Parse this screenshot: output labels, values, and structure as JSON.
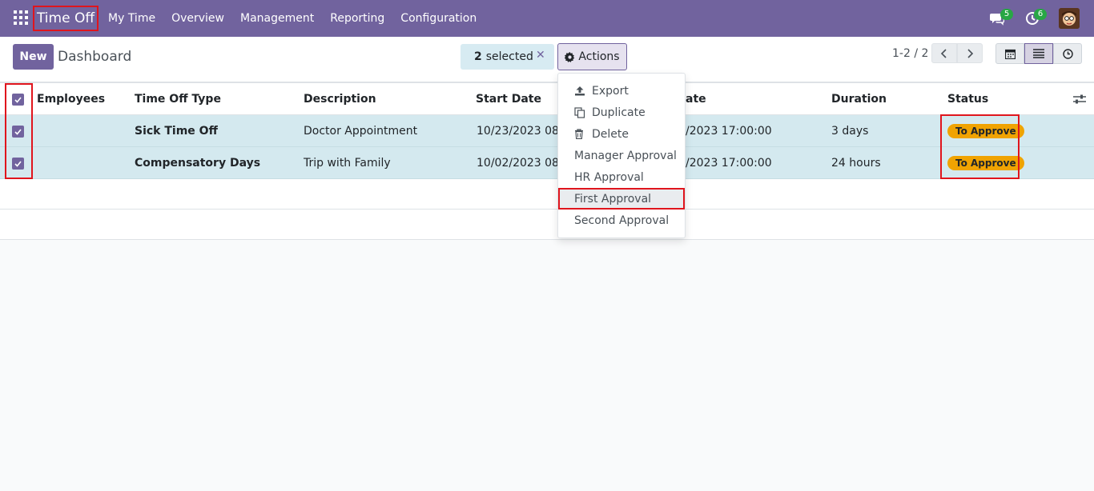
{
  "navbar": {
    "app_title": "Time Off",
    "menu": [
      "My Time",
      "Overview",
      "Management",
      "Reporting",
      "Configuration"
    ],
    "chat_count": "5",
    "activity_count": "6"
  },
  "control": {
    "new_label": "New",
    "breadcrumb": "Dashboard",
    "selected_count": "2",
    "selected_text": "selected",
    "actions_label": "Actions",
    "pager": "1-2 / 2"
  },
  "table": {
    "headers": [
      "Employees",
      "Time Off Type",
      "Description",
      "Start Date",
      "ate",
      "Duration",
      "Status"
    ],
    "rows": [
      {
        "employee": "",
        "type": "Sick Time Off",
        "description": "Doctor Appointment",
        "start": "10/23/2023 08:0",
        "end": "/2023 17:00:00",
        "duration": "3 days",
        "status": "To Approve"
      },
      {
        "employee": "",
        "type": "Compensatory Days",
        "description": "Trip with Family",
        "start": "10/02/2023 08:0",
        "end": "/2023 17:00:00",
        "duration": "24 hours",
        "status": "To Approve"
      }
    ]
  },
  "dropdown": {
    "items": [
      "Export",
      "Duplicate",
      "Delete",
      "Manager Approval",
      "HR Approval",
      "First Approval",
      "Second Approval"
    ]
  },
  "colors": {
    "brand": "#71639e",
    "highlight": "#e0151d",
    "status": "#f0a302",
    "selected_row": "#d4e9ef"
  }
}
